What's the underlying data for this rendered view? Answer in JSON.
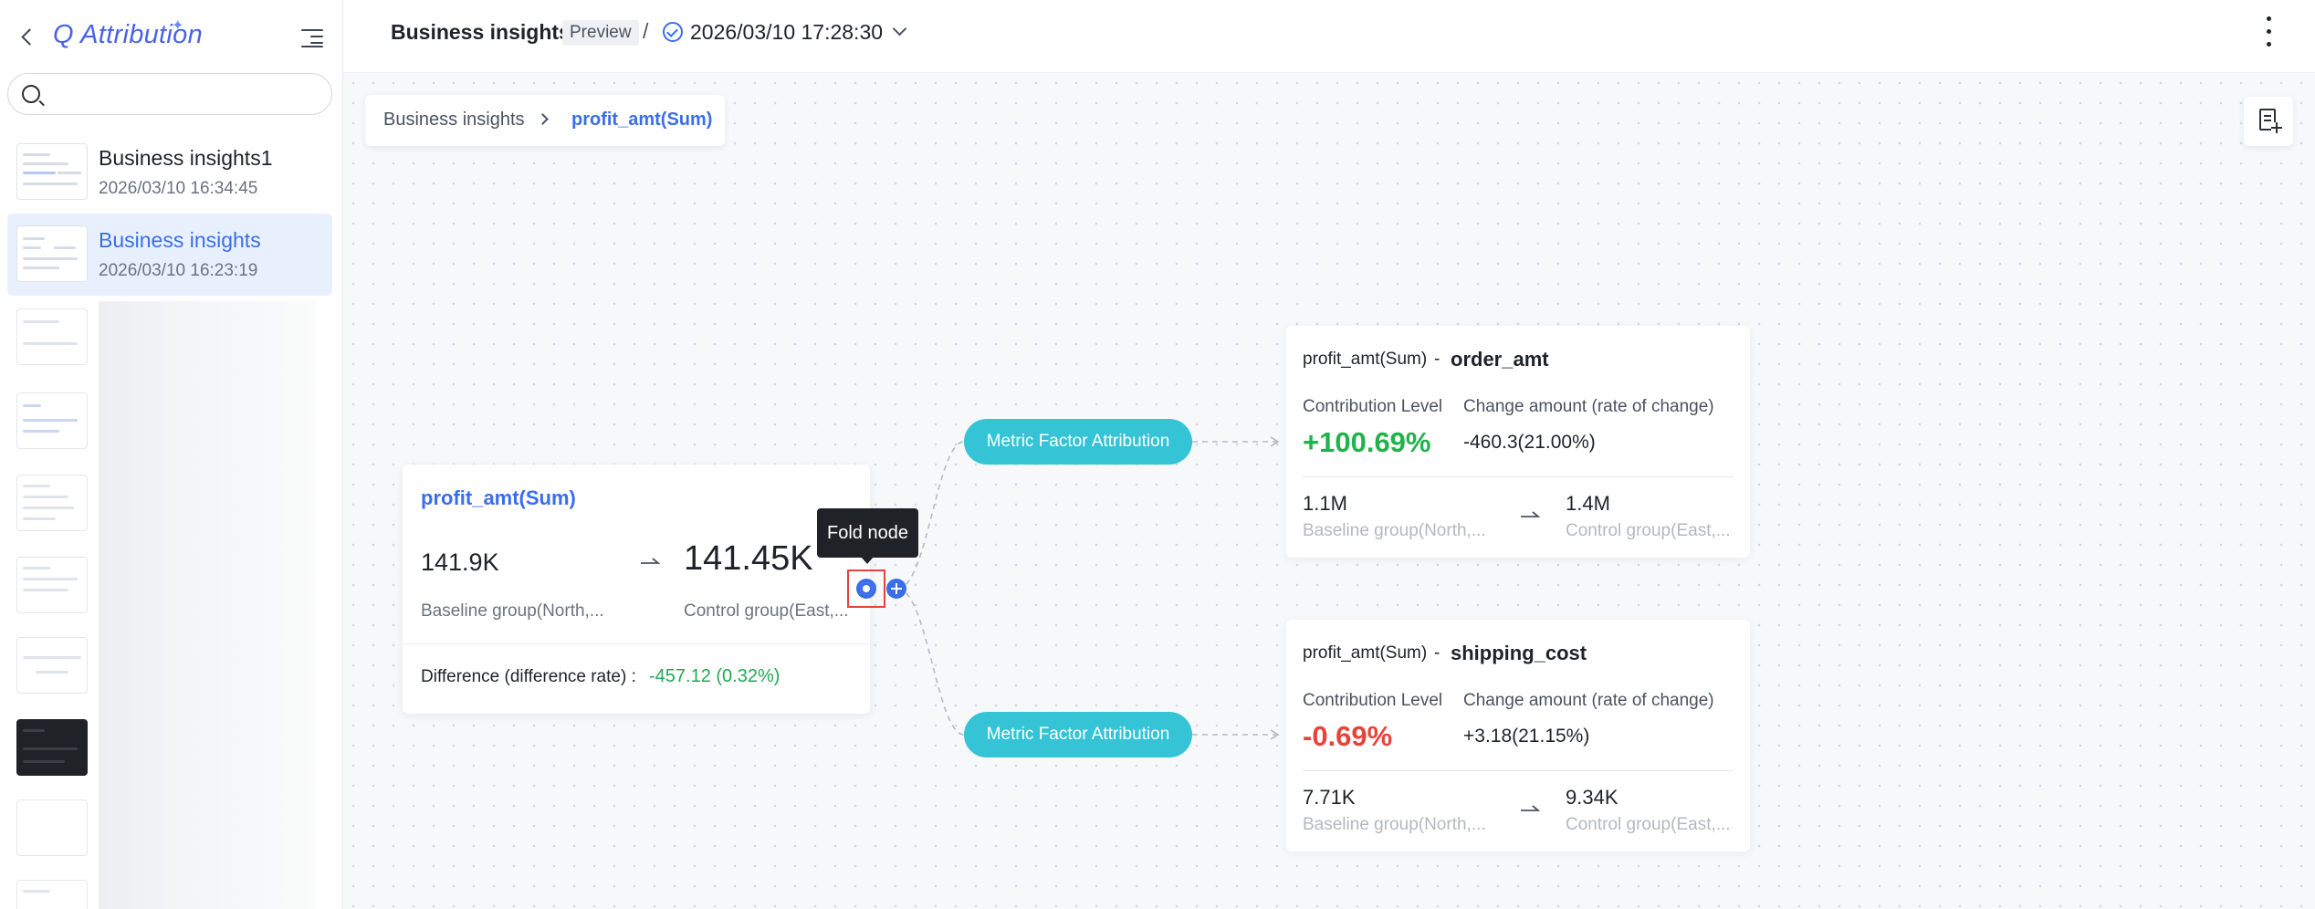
{
  "sidebar": {
    "brand": "Q Attribution",
    "search": {
      "value": "",
      "placeholder": ""
    },
    "history": [
      {
        "title": "Business insights1",
        "time": "2026/03/10 16:34:45",
        "active": false
      },
      {
        "title": "Business insights",
        "time": "2026/03/10 16:23:19",
        "active": true
      }
    ]
  },
  "topbar": {
    "title": "Business insights",
    "badge": "Preview",
    "separator": "/",
    "version_time": "2026/03/10 17:28:30"
  },
  "breadcrumb": {
    "root": "Business insights",
    "current": "profit_amt(Sum)"
  },
  "main_node": {
    "title": "profit_amt(Sum)",
    "baseline_value": "141.9K",
    "control_value": "141.45K",
    "baseline_label": "Baseline group(North,...",
    "control_label": "Control group(East,...",
    "difference_label": "Difference (difference rate) :",
    "difference_value": "-457.12 (0.32%)"
  },
  "tooltip": {
    "text": "Fold node"
  },
  "attribution_pills": [
    {
      "label": "Metric Factor Attribution"
    },
    {
      "label": "Metric Factor Attribution"
    }
  ],
  "factor_cards": [
    {
      "metric": "profit_amt(Sum)",
      "dash": "-",
      "factor": "order_amt",
      "contribution_label": "Contribution Level",
      "contribution_value": "+100.69%",
      "change_label": "Change amount (rate of change)",
      "change_value": "-460.3(21.00%)",
      "baseline_value": "1.1M",
      "baseline_label": "Baseline group(North,...",
      "control_value": "1.4M",
      "control_label": "Control group(East,..."
    },
    {
      "metric": "profit_amt(Sum)",
      "dash": "-",
      "factor": "shipping_cost",
      "contribution_label": "Contribution Level",
      "contribution_value": "-0.69%",
      "change_label": "Change amount (rate of change)",
      "change_value": "+3.18(21.15%)",
      "baseline_value": "7.71K",
      "baseline_label": "Baseline group(North,...",
      "control_value": "9.34K",
      "control_label": "Control group(East,..."
    }
  ],
  "colors": {
    "accent": "#3a6ee8",
    "pill": "#35c3d6",
    "positive": "#22b24c",
    "negative": "#e5443a",
    "highlight_box": "#e5443a"
  },
  "icons": [
    "back-arrow-icon",
    "collapse-menu-icon",
    "search-icon",
    "check-circle-icon",
    "chevron-down-icon",
    "more-vertical-icon",
    "export-document-icon",
    "fold-node-icon",
    "add-node-icon",
    "arrow-right-icon"
  ]
}
